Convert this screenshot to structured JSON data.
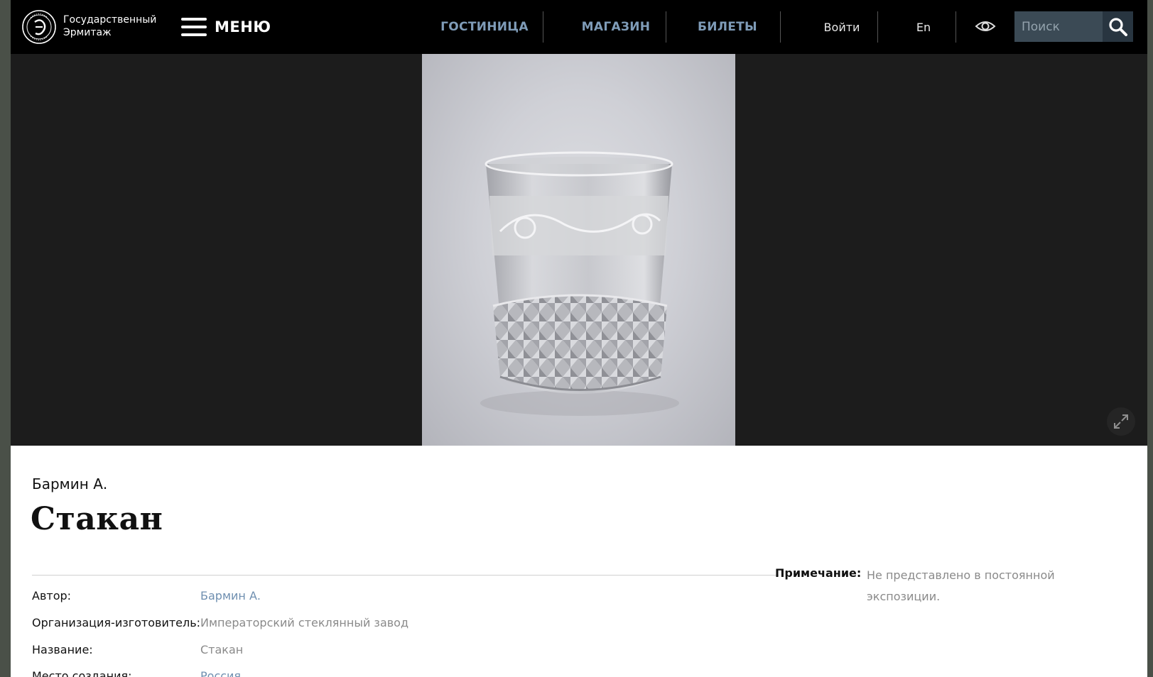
{
  "header": {
    "logo_text_line1": "Государственный",
    "logo_text_line2": "Эрмитаж",
    "menu_label": "МЕНЮ",
    "nav": [
      "ГОСТИНИЦА",
      "МАГАЗИН",
      "БИЛЕТЫ"
    ],
    "login": "Войти",
    "language": "En",
    "search_placeholder": "Поиск",
    "icons": [
      "logo-seal-icon",
      "hamburger-icon",
      "eye-icon",
      "search-icon"
    ]
  },
  "hero": {
    "image_alt": "Стакан",
    "expand_icon": "expand-icon"
  },
  "item": {
    "author": "Бармин А.",
    "title": "Стакан"
  },
  "details": [
    {
      "label": "Автор:",
      "value": "Бармин А."
    },
    {
      "label": "Организация-изготовитель:",
      "value": "Императорский стеклянный завод"
    },
    {
      "label": "Название:",
      "value": "Стакан"
    },
    {
      "label": "Место создания:",
      "value": "Россия"
    }
  ],
  "note": {
    "label": "Примечание:",
    "value": "Не представлено в постоянной экспозиции."
  },
  "colors": {
    "header_bg": "#000000",
    "nav_accent": "#7f9cb8",
    "hero_bg": "#1c1c1c",
    "link": "#6f8fb0",
    "muted": "#8a8a8a"
  }
}
